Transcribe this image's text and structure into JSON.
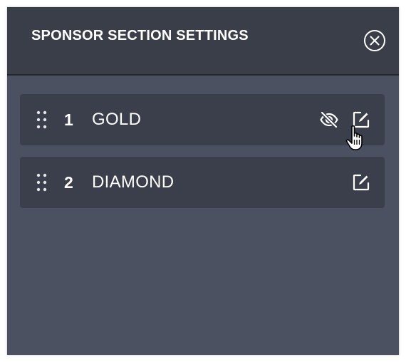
{
  "panel": {
    "title": "SPONSOR SECTION SETTINGS",
    "close_icon": "close-circle-icon"
  },
  "sections": [
    {
      "number": "1",
      "label": "GOLD",
      "icons": [
        "drag-handle-icon",
        "eye-off-icon",
        "edit-icon"
      ]
    },
    {
      "number": "2",
      "label": "DIAMOND",
      "icons": [
        "drag-handle-icon",
        "edit-icon"
      ]
    }
  ],
  "colors": {
    "header_bg": "#3a3e49",
    "panel_bg": "#4b5161",
    "row_bg": "#3b3f4b",
    "text": "#ffffff"
  }
}
